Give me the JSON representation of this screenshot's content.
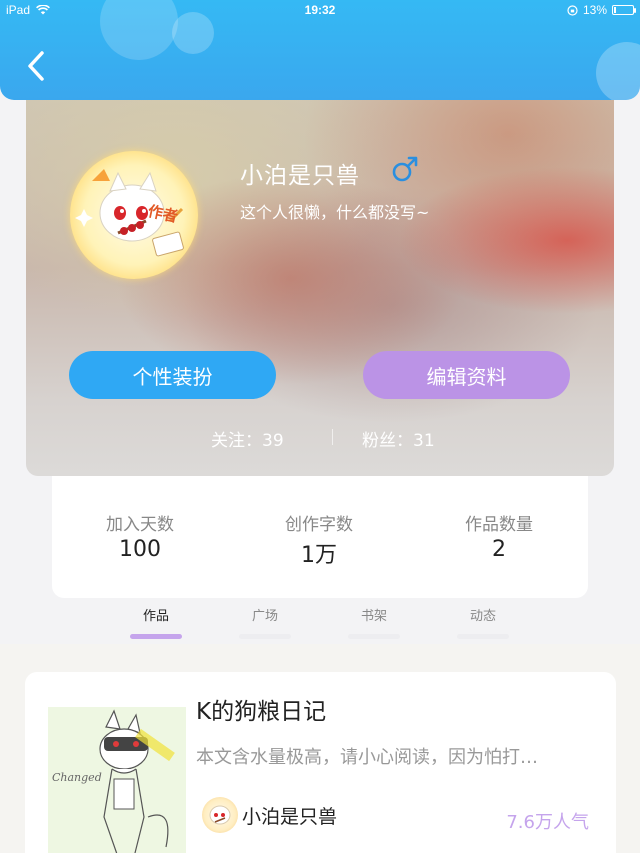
{
  "status_bar": {
    "device": "iPad",
    "time": "19:32",
    "battery": "13%",
    "battery_level": 0.13
  },
  "header": {
    "back_icon": "chevron-left-icon"
  },
  "profile": {
    "name": "小泊是只兽",
    "gender_symbol": "♂",
    "bio": "这个人很懒，什么都没写~",
    "avatar_badge": "作者",
    "decorate_button": "个性装扮",
    "edit_button": "编辑资料",
    "following_label": "关注：39",
    "fans_label": "粉丝：31"
  },
  "stats": [
    {
      "label": "加入天数",
      "value": "100"
    },
    {
      "label": "创作字数",
      "value": "1万"
    },
    {
      "label": "作品数量",
      "value": "2"
    }
  ],
  "tabs": [
    {
      "label": "作品",
      "active": true
    },
    {
      "label": "广场",
      "active": false
    },
    {
      "label": "书架",
      "active": false
    },
    {
      "label": "动态",
      "active": false
    }
  ],
  "works": [
    {
      "title": "K的狗粮日记",
      "description": "本文含水量极高，请小心阅读，因为怕打…",
      "author": "小泊是只兽",
      "popularity": "7.6万人气"
    }
  ],
  "colors": {
    "header_blue": "#35b9f4",
    "decorate_button": "#2fa8f4",
    "edit_button": "#bb93e6",
    "accent_purple": "#c5a4ec",
    "gender_blue": "#2a8fe0"
  }
}
